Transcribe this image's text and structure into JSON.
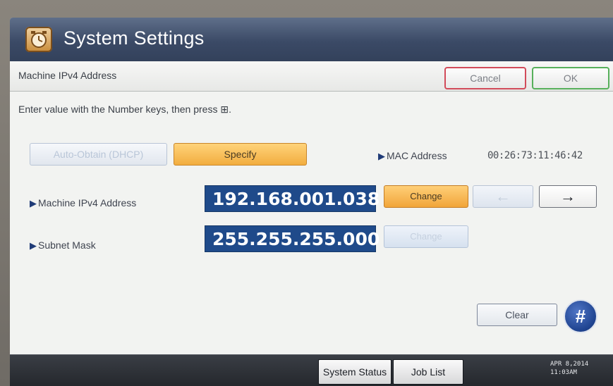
{
  "window": {
    "title": "System Settings",
    "icon": "clock-settings-icon"
  },
  "header": {
    "label": "Machine IPv4 Address",
    "cancel_label": "Cancel",
    "ok_label": "OK"
  },
  "instruction": "Enter value with the Number keys, then press ⊞.",
  "mode": {
    "auto_label": "Auto-Obtain (DHCP)",
    "specify_label": "Specify",
    "selected": "Specify"
  },
  "mac": {
    "label": "MAC Address",
    "value": "00:26:73:11:46:42"
  },
  "ipv4": {
    "label": "Machine IPv4 Address",
    "value": "192.168.001.038",
    "change_label": "Change"
  },
  "subnet": {
    "label": "Subnet Mask",
    "value": "255.255.255.000",
    "change_label": "Change"
  },
  "nav": {
    "left_arrow": "←",
    "right_arrow": "→"
  },
  "keypad": {
    "clear_label": "Clear",
    "hash_label": "#"
  },
  "bottom": {
    "system_status_label": "System Status",
    "job_list_label": "Job List",
    "date": "APR   8,2014",
    "time": "11:03AM"
  },
  "colors": {
    "title_bar": "#3b4a66",
    "value_box": "#1f4a8a",
    "selected_button": "#f2ad3f",
    "cancel_border": "#d24b5a",
    "ok_border": "#57b05b"
  }
}
